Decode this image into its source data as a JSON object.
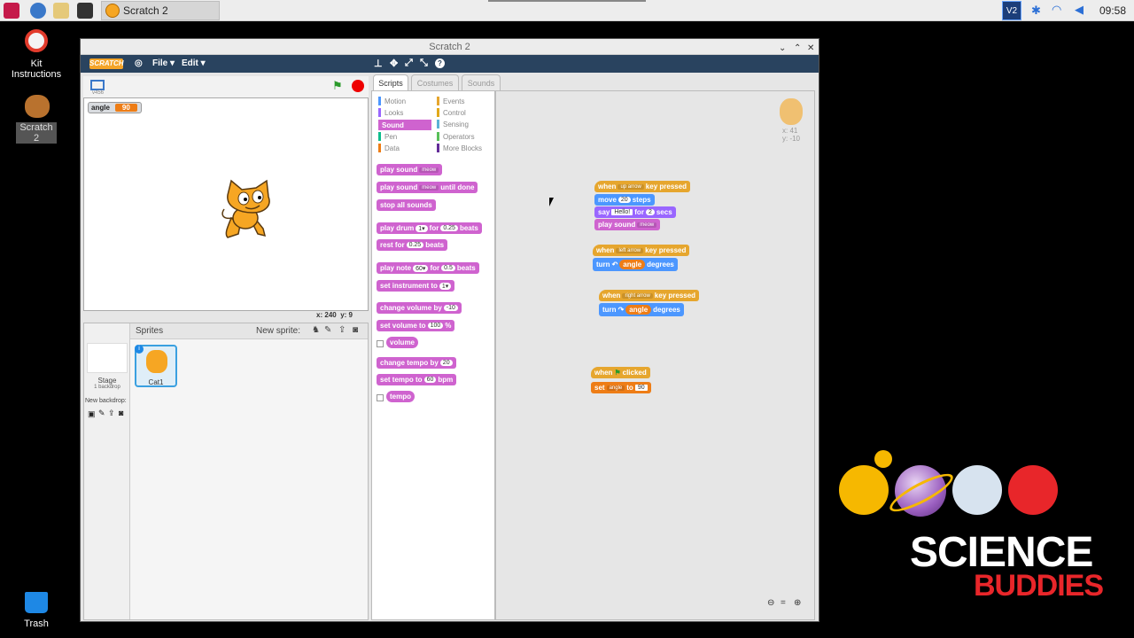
{
  "taskbar": {
    "task_label": "Scratch 2",
    "clock": "09:58",
    "tray_box": "V2"
  },
  "desktop": {
    "icons": [
      {
        "label": "Kit\nInstructions"
      },
      {
        "label": "Scratch 2"
      },
      {
        "label": "Trash"
      }
    ]
  },
  "window": {
    "title": "Scratch 2",
    "menu": {
      "logo": "SCRATCH",
      "file": "File ▾",
      "edit": "Edit ▾"
    }
  },
  "stage": {
    "version": "v456",
    "monitor_name": "angle",
    "monitor_value": "90",
    "coords_x_label": "x:",
    "coords_x": "240",
    "coords_y_label": "y:",
    "coords_y": "9"
  },
  "sprites": {
    "header": "Sprites",
    "new_sprite": "New sprite:",
    "stage_label": "Stage",
    "stage_sub": "1 backdrop",
    "new_backdrop": "New backdrop:",
    "sprite_name": "Cat1"
  },
  "tabs": [
    "Scripts",
    "Costumes",
    "Sounds"
  ],
  "categories": {
    "left": [
      "Motion",
      "Looks",
      "Sound",
      "Pen",
      "Data"
    ],
    "right": [
      "Events",
      "Control",
      "Sensing",
      "Operators",
      "More Blocks"
    ],
    "colors": {
      "Motion": "#4c97ff",
      "Looks": "#9966ff",
      "Sound": "#cf63cf",
      "Pen": "#0fbd8c",
      "Data": "#ee7d16",
      "Events": "#e6a62e",
      "Control": "#e1a91a",
      "Sensing": "#5cb1d6",
      "Operators": "#59c059",
      "More Blocks": "#632d99"
    }
  },
  "palette": {
    "play_sound": "play sound",
    "meow": "meow",
    "play_sound_until": "until done",
    "stop_all": "stop all sounds",
    "play_drum": "play drum",
    "drum_val": "1▾",
    "for": "for",
    "drum_beats": "0.25",
    "beats": "beats",
    "rest_for": "rest for",
    "rest_beats": "0.25",
    "play_note": "play note",
    "note_val": "60▾",
    "note_beats": "0.5",
    "set_instrument": "set instrument to",
    "instrument_val": "1▾",
    "change_volume": "change volume by",
    "volume_delta": "-10",
    "set_volume": "set volume to",
    "volume_val": "100",
    "percent": "%",
    "volume": "volume",
    "change_tempo": "change tempo by",
    "tempo_delta": "20",
    "set_tempo": "set tempo to",
    "tempo_val": "60",
    "bpm": "bpm",
    "tempo": "tempo"
  },
  "sprite_info": {
    "x": "x: 41",
    "y": "y: -10"
  },
  "scripts": {
    "s1": {
      "when": "when",
      "key": "up arrow",
      "pressed": "key pressed",
      "move": "move",
      "steps_val": "20",
      "steps": "steps",
      "say": "say",
      "say_val": "Hello!",
      "for": "for",
      "secs_val": "2",
      "secs": "secs",
      "play_sound": "play sound",
      "sound_val": "meow"
    },
    "s2": {
      "when": "when",
      "key": "left arrow",
      "pressed": "key pressed",
      "turn": "turn",
      "angle": "angle",
      "degrees": "degrees"
    },
    "s3": {
      "when": "when",
      "key": "right arrow",
      "pressed": "key pressed",
      "turn": "turn",
      "angle": "angle",
      "degrees": "degrees"
    },
    "s4": {
      "when": "when",
      "clicked": "clicked",
      "set": "set",
      "var": "angle",
      "to": "to",
      "val": "90"
    }
  },
  "branding": {
    "line1": "SCIENCE",
    "line2": "BUDDIES"
  }
}
